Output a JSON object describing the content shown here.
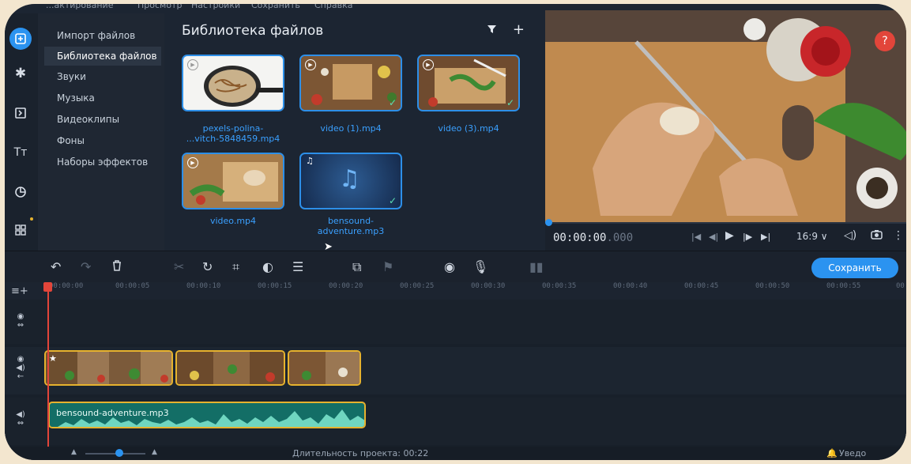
{
  "menu": [
    "...актирование",
    "Просмотр",
    "Настройки",
    "Сохранить",
    "Справка"
  ],
  "sidebar_icons": [
    "import-icon",
    "pin-icon",
    "transition-icon",
    "text-icon",
    "sticker-icon",
    "apps-icon"
  ],
  "categories": [
    "Импорт файлов",
    "Библиотека файлов",
    "Звуки",
    "Музыка",
    "Видеоклипы",
    "Фоны",
    "Наборы эффектов"
  ],
  "active_category": "Библиотека файлов",
  "library": {
    "title": "Библиотека файлов",
    "filter_icon": "filter-icon",
    "add_icon": "plus-icon",
    "items": [
      {
        "caption": "pexels-polina-\n...vitch-5848459.mp4",
        "type": "video",
        "checked": false
      },
      {
        "caption": "video (1).mp4",
        "type": "video",
        "checked": true
      },
      {
        "caption": "video (3).mp4",
        "type": "video",
        "checked": true
      },
      {
        "caption": "video.mp4",
        "type": "video",
        "checked": false
      },
      {
        "caption": "bensound-\nadventure.mp3",
        "type": "audio",
        "checked": true
      }
    ]
  },
  "player": {
    "timecode_main": "00:00:00",
    "timecode_ms": ".000",
    "aspect": "16:9 ∨",
    "help": "?"
  },
  "toolbar": {
    "save_label": "Сохранить"
  },
  "ruler_ticks": [
    "00:00:00",
    "00:00:05",
    "00:00:10",
    "00:00:15",
    "00:00:20",
    "00:00:25",
    "00:00:30",
    "00:00:35",
    "00:00:40",
    "00:00:45",
    "00:00:50",
    "00:00:55",
    "00"
  ],
  "audio_clip": {
    "name": "bensound-adventure.mp3"
  },
  "status": {
    "duration": "Длительность проекта: 00:22",
    "notifications": "Уведо"
  },
  "colors": {
    "accent": "#2b93f0",
    "clip_border": "#e6b22e",
    "audio_fill": "#136e66",
    "playhead": "#e2453a"
  }
}
